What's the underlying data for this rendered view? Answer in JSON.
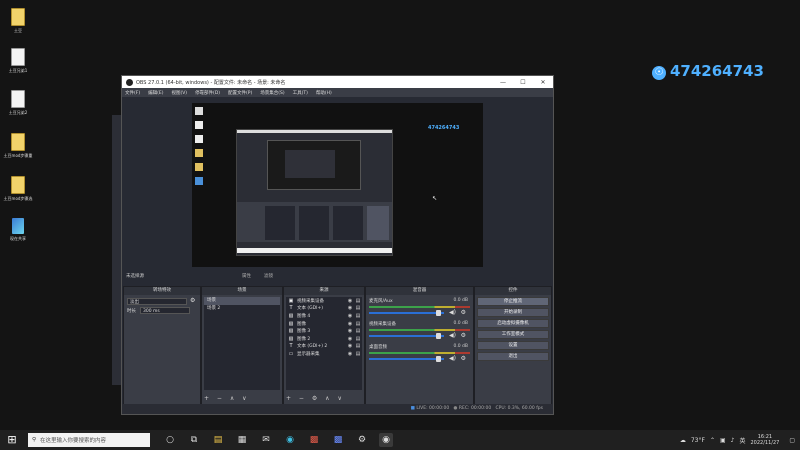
{
  "desktop": {
    "icons": [
      {
        "label": "土豆",
        "kind": "file"
      },
      {
        "label": "土豆兄弟1",
        "kind": "page"
      },
      {
        "label": "土豆兄弟2",
        "kind": "page"
      },
      {
        "label": "土豆mod步骤重",
        "kind": "file"
      },
      {
        "label": "土豆mod步骤选",
        "kind": "file"
      },
      {
        "label": "现在共享",
        "kind": "app"
      }
    ]
  },
  "watermark": {
    "qq_glyph": "☉",
    "number": "474264743"
  },
  "obs": {
    "title": "OBS 27.0.1 (64-bit, windows) - 配置文件: 未命名 - 场景: 未命名",
    "window_buttons": {
      "minimize": "—",
      "maximize": "☐",
      "close": "✕"
    },
    "menu": [
      "文件(F)",
      "编辑(E)",
      "视图(V)",
      "停靠部件(D)",
      "配置文件(P)",
      "场景集合(S)",
      "工具(T)",
      "帮助(H)"
    ],
    "preview_watermark": "474264743",
    "scene_info": "未选择源",
    "mini_options": [
      "属性",
      "滤镜"
    ],
    "panels": {
      "transitions": {
        "title": "转场特效",
        "type": "淡出",
        "duration_label": "时长",
        "duration_value": "300 ms"
      },
      "scenes": {
        "title": "场景",
        "items": [
          "场景",
          "场景 2"
        ],
        "footer": "+ − ∧ ∨"
      },
      "sources": {
        "title": "来源",
        "items": [
          {
            "icon": "▣",
            "name": "视频采集设备"
          },
          {
            "icon": "T",
            "name": "文本 (GDI+)"
          },
          {
            "icon": "▧",
            "name": "图像 4"
          },
          {
            "icon": "▧",
            "name": "图像"
          },
          {
            "icon": "▧",
            "name": "图像 3"
          },
          {
            "icon": "▧",
            "name": "图像 2"
          },
          {
            "icon": "T",
            "name": "文本 (GDI+) 2"
          },
          {
            "icon": "▭",
            "name": "显示器采集"
          }
        ],
        "eye": "◉",
        "lock": "▤",
        "footer": "+ − ⚙ ∧ ∨"
      },
      "mixer": {
        "title": "混音器",
        "channels": [
          {
            "name": "麦克风/Aux",
            "db": "0.0 dB",
            "volume": 0.95
          },
          {
            "name": "视频采集设备",
            "db": "0.0 dB",
            "volume": 0.95
          },
          {
            "name": "桌面音频",
            "db": "0.0 dB",
            "volume": 0.95
          }
        ],
        "speaker_glyph": "◀)",
        "cog_glyph": "⚙"
      },
      "controls": {
        "title": "控件",
        "buttons": [
          "停止推流",
          "开始录制",
          "启动虚拟摄像机",
          "工作室模式",
          "设置",
          "退出"
        ]
      }
    },
    "status": {
      "live": "LIVE: 00:00:00",
      "rec": "REC: 00:00:00",
      "cpu": "CPU: 0.3%, 60.00 fps"
    }
  },
  "taskbar": {
    "start_glyph": "⊞",
    "search_placeholder": "在这里输入你要搜索的内容",
    "weather": "73°F",
    "lang": "英",
    "time": "16:21",
    "date": "2022/11/27"
  }
}
